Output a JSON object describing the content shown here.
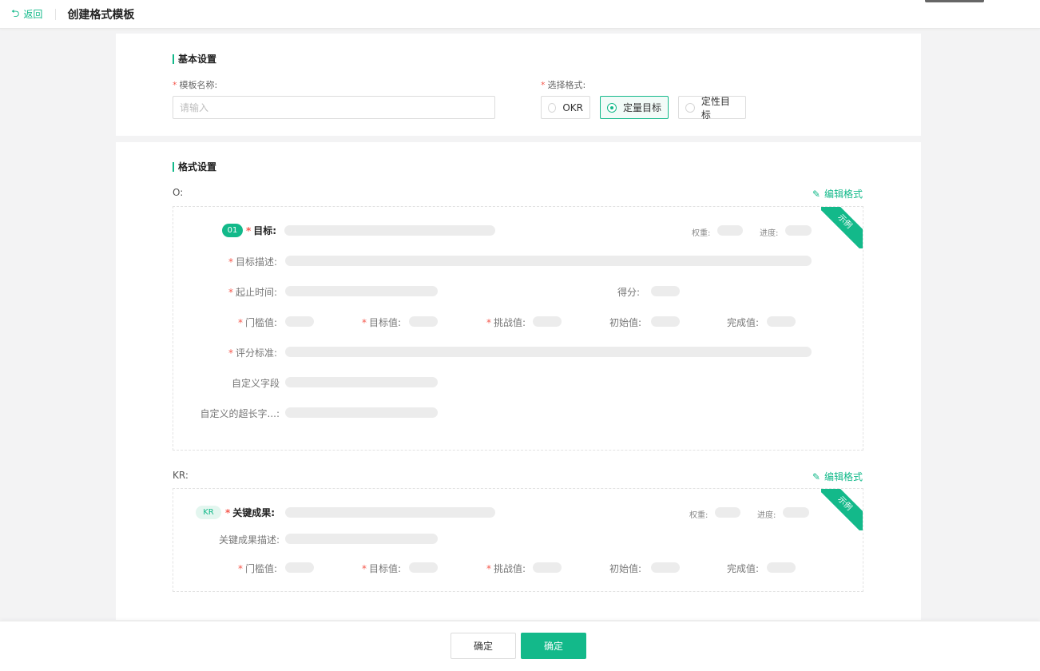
{
  "header": {
    "back_label": "返回",
    "back_icon": "undo-arrow-icon",
    "title": "创建格式模板"
  },
  "basic": {
    "section_title": "基本设置",
    "name_label": "模板名称:",
    "name_placeholder": "请输入",
    "format_label": "选择格式:",
    "format_options": [
      "OKR",
      "定量目标",
      "定性目标"
    ],
    "format_selected": "定量目标"
  },
  "format": {
    "section_title": "格式设置",
    "edit_label": "编辑格式",
    "ribbon_label": "示例",
    "o": {
      "group_label": "O:",
      "badge": "01",
      "goal_label": "目标:",
      "weight_label": "权重:",
      "progress_label": "进度:",
      "desc_label": "目标描述:",
      "time_label": "起止时间:",
      "score_label": "得分:",
      "threshold_label": "门槛值:",
      "target_label": "目标值:",
      "challenge_label": "挑战值:",
      "initial_label": "初始值:",
      "complete_label": "完成值:",
      "criteria_label": "评分标准:",
      "custom_label": "自定义字段",
      "custom_long_label": "自定义的超长字...:"
    },
    "kr": {
      "group_label": "KR:",
      "badge": "KR",
      "result_label": "关键成果:",
      "weight_label": "权重:",
      "progress_label": "进度:",
      "desc_label": "关键成果描述:",
      "threshold_label": "门槛值:",
      "target_label": "目标值:",
      "challenge_label": "挑战值:",
      "initial_label": "初始值:",
      "complete_label": "完成值:"
    }
  },
  "footer": {
    "cancel_label": "确定",
    "confirm_label": "确定"
  },
  "colors": {
    "accent": "#13b98a",
    "required": "#f5594e",
    "placeholder_bar": "#ececec"
  }
}
